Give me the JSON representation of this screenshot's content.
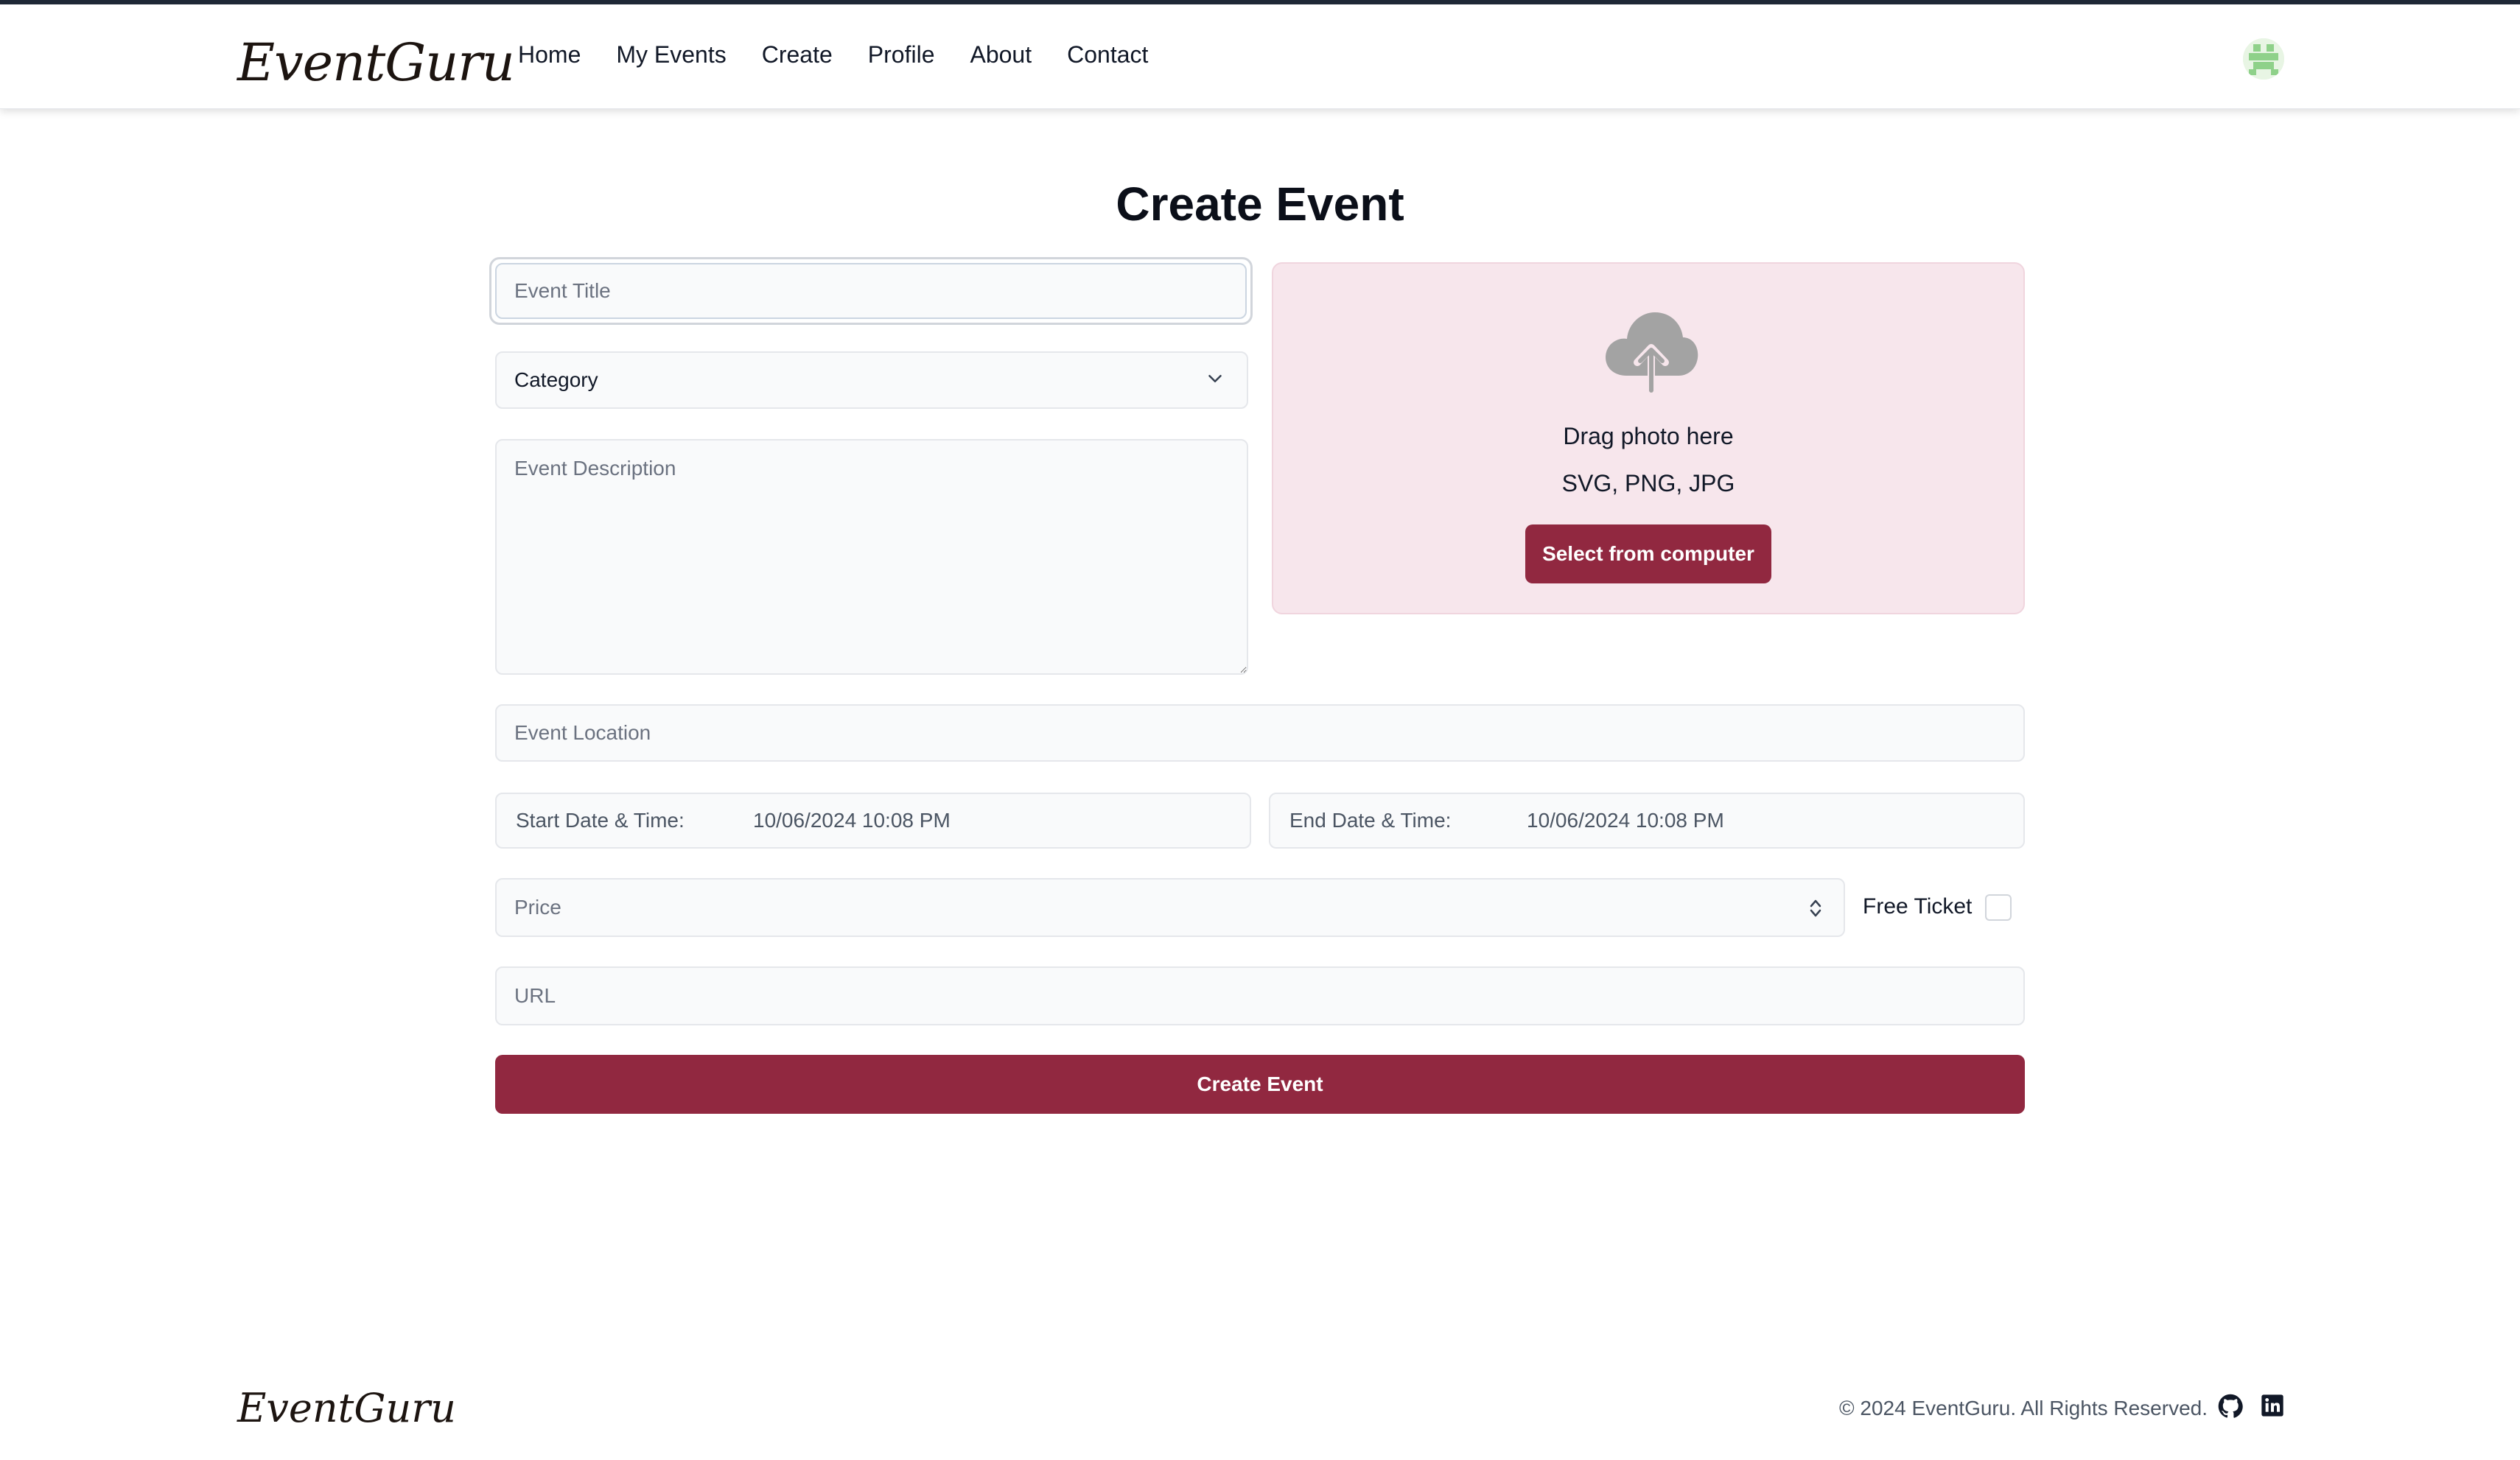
{
  "brand": {
    "logo": "EventGuru",
    "footer_logo": "EventGuru"
  },
  "nav": {
    "items": [
      {
        "label": "Home"
      },
      {
        "label": "My Events"
      },
      {
        "label": "Create"
      },
      {
        "label": "Profile"
      },
      {
        "label": "About"
      },
      {
        "label": "Contact"
      }
    ]
  },
  "page": {
    "title": "Create Event"
  },
  "form": {
    "title_placeholder": "Event Title",
    "category_value": "Category",
    "description_placeholder": "Event Description",
    "location_placeholder": "Event Location",
    "start_label": "Start Date & Time:",
    "start_value": "10/06/2024 10:08 PM",
    "end_label": "End Date & Time:",
    "end_value": "10/06/2024 10:08 PM",
    "price_placeholder": "Price",
    "free_ticket_label": "Free Ticket",
    "free_ticket_checked": false,
    "url_placeholder": "URL",
    "submit_label": "Create Event"
  },
  "upload": {
    "icon": "cloud-upload-icon",
    "drag_text": "Drag photo here",
    "types_text": "SVG, PNG, JPG",
    "button_label": "Select from computer"
  },
  "footer": {
    "copyright": "© 2024 EventGuru. All Rights Reserved.",
    "icons": [
      "github-icon",
      "linkedin-icon"
    ]
  },
  "colors": {
    "accent": "#912840",
    "upload_bg": "#f7e6ec",
    "field_bg": "#f9fafb"
  }
}
